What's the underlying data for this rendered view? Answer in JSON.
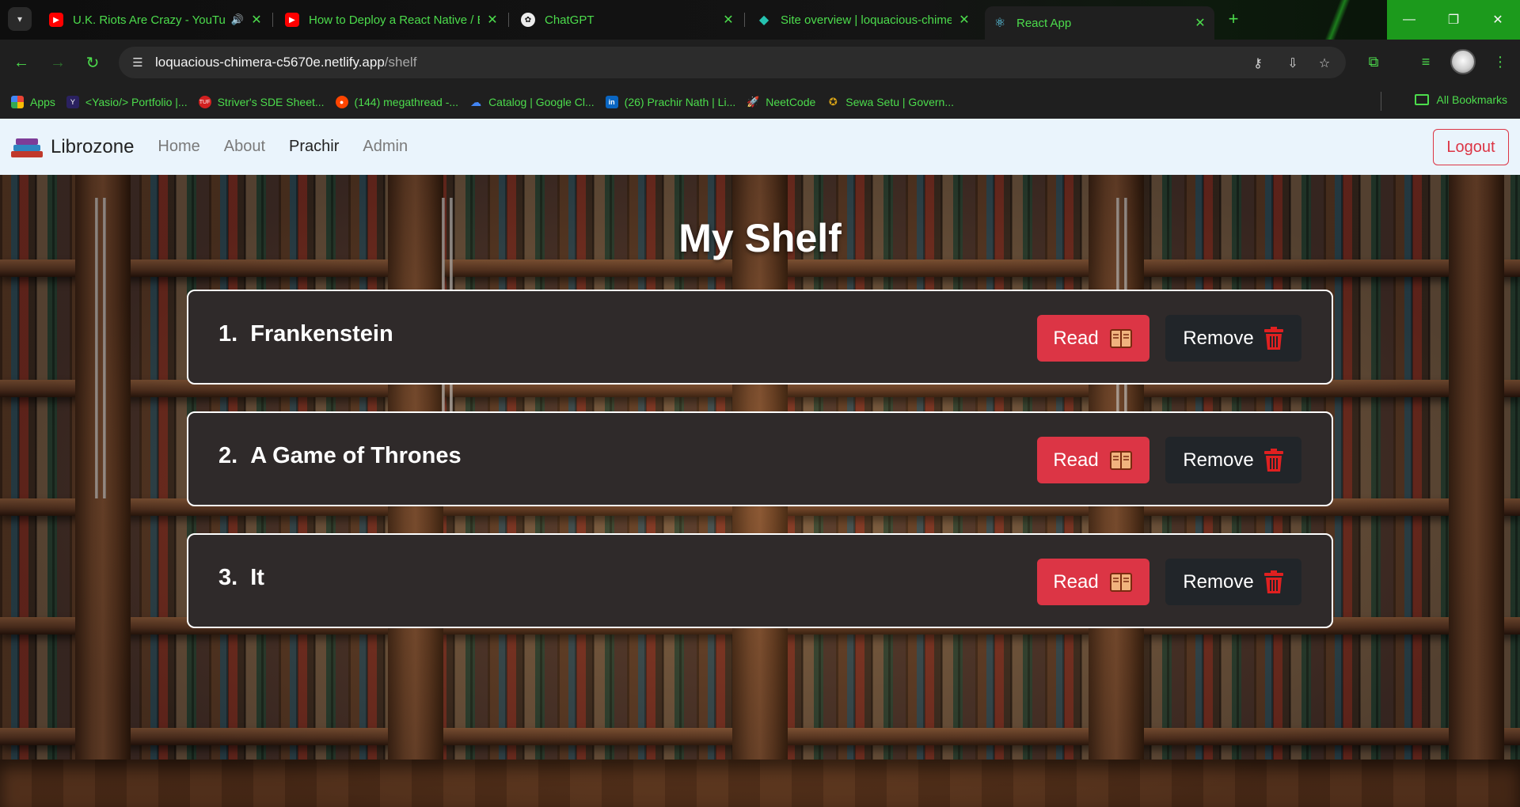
{
  "browser": {
    "tabs": [
      {
        "title": "U.K. Riots Are Crazy - YouTube",
        "favicon": "youtube-icon",
        "audio": true
      },
      {
        "title": "How to Deploy a React Native / Expo",
        "favicon": "youtube-icon"
      },
      {
        "title": "ChatGPT",
        "favicon": "chatgpt-icon"
      },
      {
        "title": "Site overview | loquacious-chimera",
        "favicon": "netlify-icon"
      },
      {
        "title": "React App",
        "favicon": "react-icon",
        "active": true
      }
    ],
    "address": {
      "host": "loquacious-chimera-c5670e.netlify.app",
      "path": "/shelf"
    },
    "bookmarks": [
      {
        "label": "Apps",
        "icon": "apps-grid-icon"
      },
      {
        "label": "<Yasio/> Portfolio |...",
        "icon": "portfolio-icon"
      },
      {
        "label": "Striver's SDE Sheet...",
        "icon": "tuf-icon"
      },
      {
        "label": "(144) megathread -...",
        "icon": "reddit-icon"
      },
      {
        "label": "Catalog | Google Cl...",
        "icon": "google-cloud-icon"
      },
      {
        "label": "(26) Prachir Nath | Li...",
        "icon": "linkedin-icon"
      },
      {
        "label": "NeetCode",
        "icon": "rocket-icon"
      },
      {
        "label": "Sewa Setu | Govern...",
        "icon": "emblem-icon"
      }
    ],
    "all_bookmarks": "All Bookmarks"
  },
  "navbar": {
    "brand": "Librozone",
    "links": [
      "Home",
      "About",
      "Prachir",
      "Admin"
    ],
    "active_link": "Prachir",
    "logout": "Logout"
  },
  "shelf": {
    "title": "My Shelf",
    "books": [
      {
        "num": "1.",
        "title": "Frankenstein"
      },
      {
        "num": "2.",
        "title": "A Game of Thrones"
      },
      {
        "num": "3.",
        "title": "It"
      }
    ],
    "read_label": "Read",
    "remove_label": "Remove"
  },
  "colors": {
    "accent_green": "#4cdc4c",
    "danger": "#dc3545",
    "dark_button": "#212529",
    "navbar_bg": "#eaf4fc",
    "card_bg": "#2f2a2a"
  }
}
